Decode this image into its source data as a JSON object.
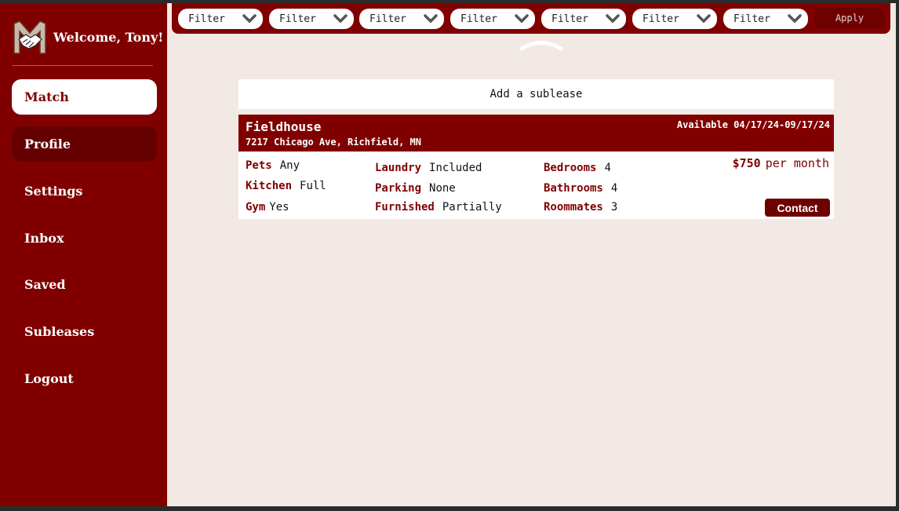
{
  "app": {
    "welcome": "Welcome, Tony!",
    "logo_icon": "handshake-logo-icon",
    "brand_color": "#800000"
  },
  "sidebar": {
    "items": [
      {
        "label": "Match",
        "state": "active"
      },
      {
        "label": "Profile",
        "state": "hover"
      },
      {
        "label": "Settings",
        "state": "normal"
      },
      {
        "label": "Inbox",
        "state": "normal"
      },
      {
        "label": "Saved",
        "state": "normal"
      },
      {
        "label": "Subleases",
        "state": "normal"
      },
      {
        "label": "Logout",
        "state": "normal"
      }
    ]
  },
  "filters": {
    "items": [
      {
        "label": "Filter"
      },
      {
        "label": "Filter"
      },
      {
        "label": "Filter"
      },
      {
        "label": "Filter"
      },
      {
        "label": "Filter"
      },
      {
        "label": "Filter"
      },
      {
        "label": "Filter"
      }
    ],
    "apply_label": "Apply",
    "collapse_icon": "chevron-up-icon"
  },
  "main": {
    "add_sublease_label": "Add a sublease",
    "listing": {
      "title": "Fieldhouse",
      "address": "7217 Chicago Ave, Richfield, MN",
      "availability": "Available 04/17/24-09/17/24",
      "price": "$750",
      "price_unit": "per month",
      "contact_label": "Contact",
      "attributes": [
        {
          "key": "Pets",
          "value": "Any"
        },
        {
          "key": "Kitchen",
          "value": "Full"
        },
        {
          "key": "Gym",
          "value": "Yes"
        },
        {
          "key": "Laundry",
          "value": "Included"
        },
        {
          "key": "Parking",
          "value": "None"
        },
        {
          "key": "Furnished",
          "value": "Partially"
        },
        {
          "key": "Bedrooms",
          "value": "4"
        },
        {
          "key": "Bathrooms",
          "value": "4"
        },
        {
          "key": "Roommates",
          "value": "3"
        }
      ]
    }
  }
}
